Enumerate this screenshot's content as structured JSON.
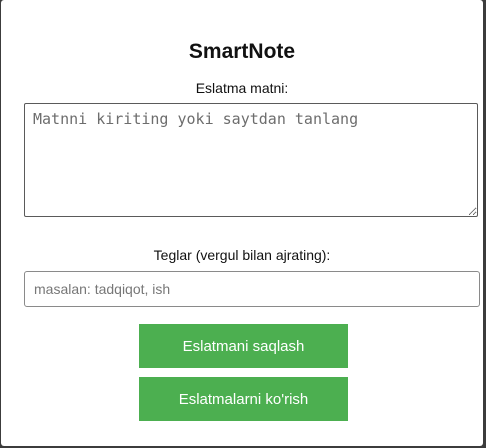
{
  "app": {
    "title": "SmartNote"
  },
  "note": {
    "label": "Eslatma matni:",
    "value": "",
    "placeholder": "Matnni kiriting yoki saytdan tanlang"
  },
  "tags": {
    "label": "Teglar (vergul bilan ajrating):",
    "value": "",
    "placeholder": "masalan: tadqiqot, ish"
  },
  "buttons": {
    "save_label": "Eslatmani saqlash",
    "view_label": "Eslatmalarni ko'rish"
  },
  "colors": {
    "button_bg": "#4caf50",
    "button_text": "#ffffff",
    "frame": "#3c3c3c"
  }
}
